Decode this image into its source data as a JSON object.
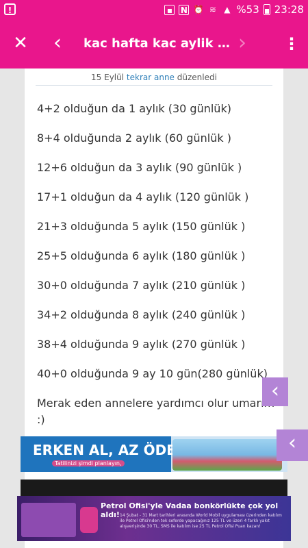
{
  "status_bar": {
    "left_icon": "notification-icon",
    "battery_text": "%53",
    "time": "23:28"
  },
  "toolbar": {
    "close_glyph": "✕",
    "back_glyph": "‹",
    "title": "kac hafta kac aylik oluyo...",
    "forward_glyph": "›",
    "more_glyph": "⋮"
  },
  "post": {
    "edit_note": {
      "date": "15 Eylül",
      "user": "tekrar anne",
      "action": "düzenledi"
    },
    "lines": [
      "4+2 olduğun da 1 aylık (30 günlük)",
      "8+4 olduğunda 2 aylık (60 günlük )",
      "12+6 olduğun da 3 aylık (90 günlük )",
      "17+1 olduğun da 4 aylık (120 günlük )",
      "21+3 olduğunda 5 aylık (150 günlük )",
      "25+5 olduğunda 6 aylık (180 günlük )",
      "30+0 olduğunda 7 aylık (210 günlük )",
      "34+2 olduğunda 8 aylık (240 günlük )",
      "38+4 olduğunda 9 aylık (270 günlük )",
      "40+0 olduğunda 9 ay 10 gün(280 günlük)"
    ],
    "closing_line_1": "Merak eden annelere yardımcı olur umarım",
    "closing_line_2": ":)"
  },
  "side_tabs": {
    "glyph": "‹"
  },
  "banner": {
    "headline": "ERKEN AL, AZ ÖDE!",
    "sub": "Tatilinizi şimdi planlayın,"
  },
  "ad": {
    "headline": "Petrol Ofisi'yle Vadaa bonkörlükte çok yol aldı!",
    "fine_print": "14 Şubat - 31 Mart tarihleri arasında World Mobil uygulaması üzerinden katılım ile Petrol Ofisi'nden tek seferde yapacağınız 125 TL ve üzeri 4 farklı yakıt alışverişinde 30 TL, SMS ile katılım ise 25 TL Petrol Ofisi Puan kazan!"
  },
  "colors": {
    "brand": "#e9168c",
    "side_tab": "#b384d6",
    "link": "#2e7fb8"
  }
}
